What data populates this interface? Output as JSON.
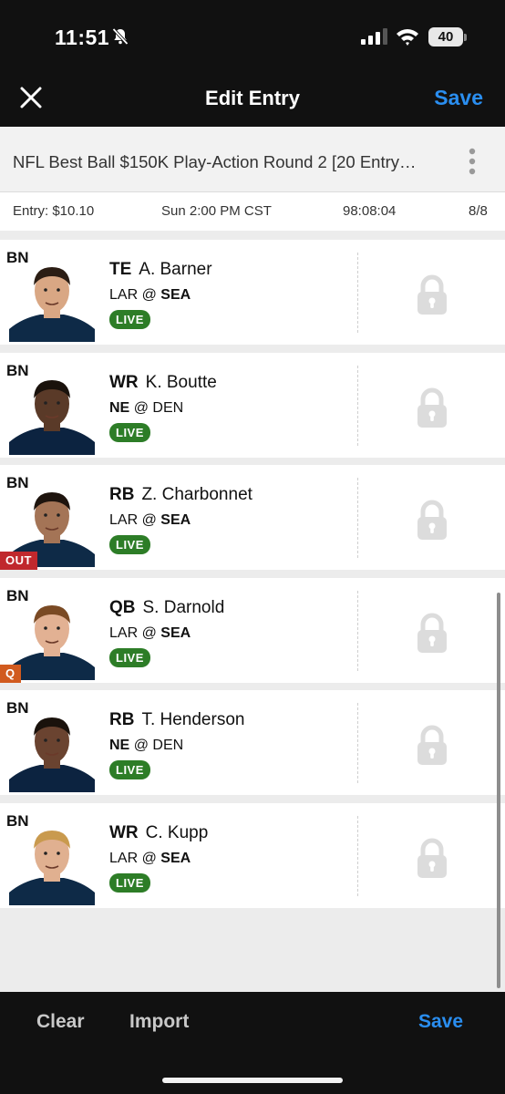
{
  "status_bar": {
    "time": "11:51",
    "battery": "40"
  },
  "nav": {
    "title": "Edit Entry",
    "save_label": "Save"
  },
  "contest": {
    "name": "NFL Best Ball $150K Play-Action Round 2 [20 Entry…"
  },
  "entry_info": {
    "entry": "Entry: $10.10",
    "start_time": "Sun 2:00 PM CST",
    "countdown": "98:08:04",
    "count": "8/8"
  },
  "players": [
    {
      "slot": "BN",
      "position": "TE",
      "name": "A. Barner",
      "away": "LAR",
      "at": "@",
      "home": "SEA",
      "bold_team": "home",
      "live": "LIVE",
      "status": "",
      "jersey": "#0e2a47",
      "skin": "#d9a784",
      "hair": "#2b1d14"
    },
    {
      "slot": "BN",
      "position": "WR",
      "name": "K. Boutte",
      "away": "NE",
      "at": "@",
      "home": "DEN",
      "bold_team": "away",
      "live": "LIVE",
      "status": "",
      "jersey": "#0c2340",
      "skin": "#5a3a28",
      "hair": "#1a120c"
    },
    {
      "slot": "BN",
      "position": "RB",
      "name": "Z. Charbonnet",
      "away": "LAR",
      "at": "@",
      "home": "SEA",
      "bold_team": "home",
      "live": "LIVE",
      "status": "OUT",
      "jersey": "#0e2a47",
      "skin": "#a47456",
      "hair": "#1e140e"
    },
    {
      "slot": "BN",
      "position": "QB",
      "name": "S. Darnold",
      "away": "LAR",
      "at": "@",
      "home": "SEA",
      "bold_team": "home",
      "live": "LIVE",
      "status": "Q",
      "jersey": "#0e2a47",
      "skin": "#e2b193",
      "hair": "#7a4a24"
    },
    {
      "slot": "BN",
      "position": "RB",
      "name": "T. Henderson",
      "away": "NE",
      "at": "@",
      "home": "DEN",
      "bold_team": "away",
      "live": "LIVE",
      "status": "",
      "jersey": "#0c2340",
      "skin": "#6a4330",
      "hair": "#1a120c"
    },
    {
      "slot": "BN",
      "position": "WR",
      "name": "C. Kupp",
      "away": "LAR",
      "at": "@",
      "home": "SEA",
      "bold_team": "home",
      "live": "LIVE",
      "status": "",
      "jersey": "#0e2a47",
      "skin": "#e0b090",
      "hair": "#c99a4e"
    }
  ],
  "bottom_bar": {
    "clear_label": "Clear",
    "import_label": "Import",
    "save_label": "Save"
  },
  "colors": {
    "accent": "#2a8ef0",
    "live": "#2d7d27",
    "out": "#c0282d",
    "questionable": "#d15a1e"
  },
  "icons": {
    "close": "close-icon",
    "more": "more-vertical-icon",
    "lock": "lock-icon"
  }
}
